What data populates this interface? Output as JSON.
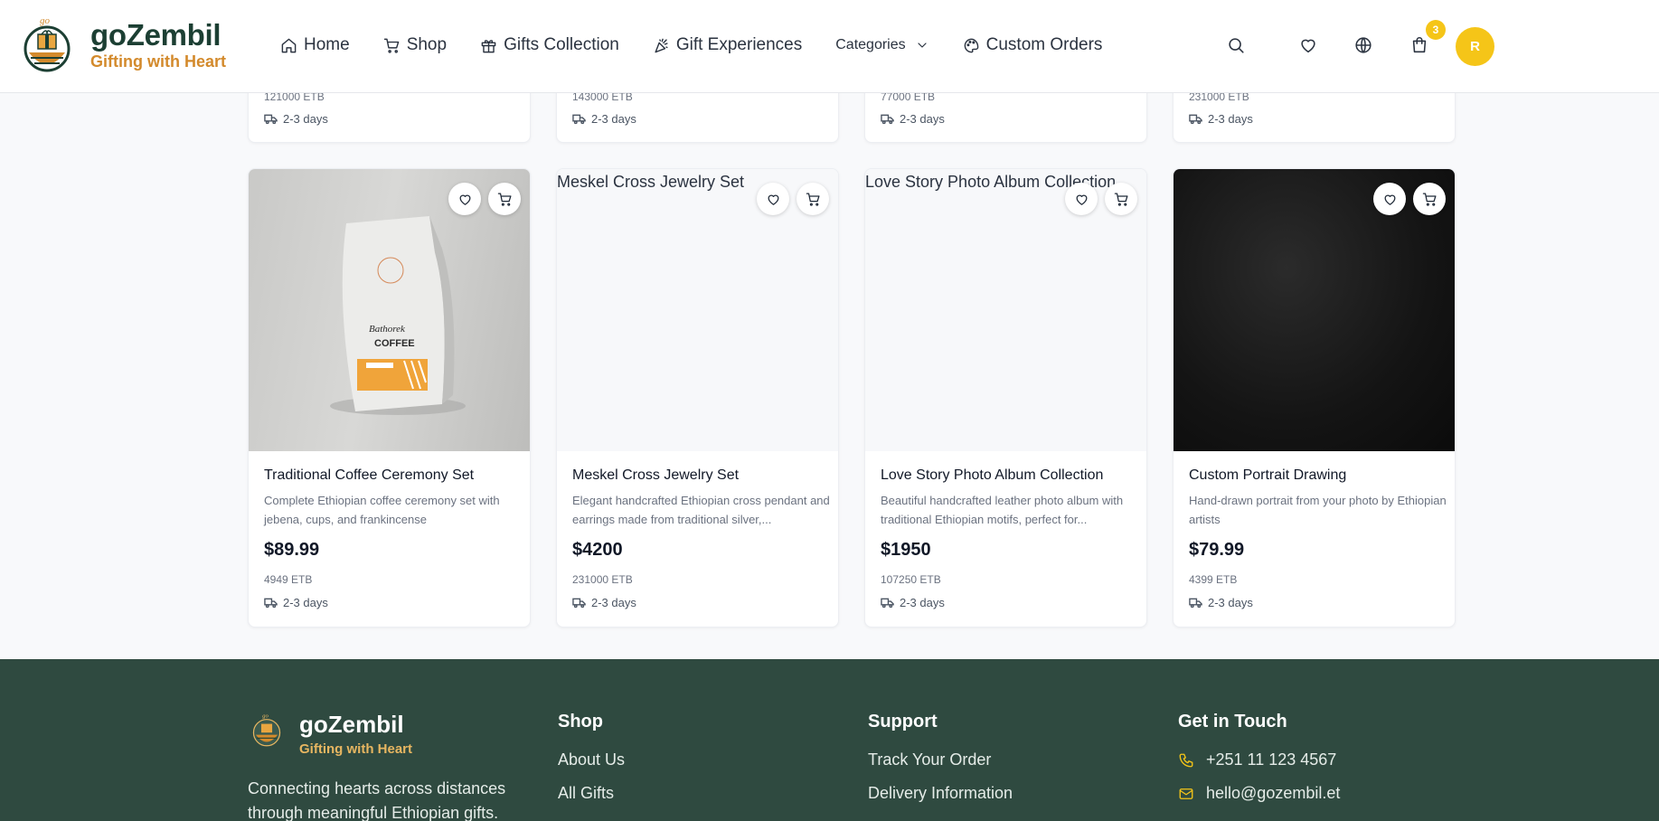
{
  "header": {
    "brand_name": "goZembil",
    "brand_tagline": "Gifting with Heart",
    "logo_text": "go",
    "nav": [
      {
        "label": "Home",
        "icon": "home-icon"
      },
      {
        "label": "Shop",
        "icon": "cart-icon"
      },
      {
        "label": "Gifts Collection",
        "icon": "gift-icon"
      },
      {
        "label": "Gift Experiences",
        "icon": "party-popper-icon"
      },
      {
        "label": "Categories",
        "icon": "chevron-down-icon"
      },
      {
        "label": "Custom Orders",
        "icon": "palette-icon"
      }
    ],
    "cart_count": "3",
    "avatar_initial": "R"
  },
  "top_row": [
    {
      "etb": "121000 ETB",
      "shipping": "2-3 days"
    },
    {
      "etb": "143000 ETB",
      "shipping": "2-3 days"
    },
    {
      "etb": "77000 ETB",
      "shipping": "2-3 days"
    },
    {
      "etb": "231000 ETB",
      "shipping": "2-3 days"
    }
  ],
  "products": [
    {
      "title": "Traditional Coffee Ceremony Set",
      "description": "Complete Ethiopian coffee ceremony set with jebena, cups, and frankincense",
      "price": "$89.99",
      "etb": "4949 ETB",
      "shipping": "2-3 days",
      "image_alt": "",
      "bag_text_1": "Bathorek",
      "bag_text_2": "COFFEE"
    },
    {
      "title": "Meskel Cross Jewelry Set",
      "description": "Elegant handcrafted Ethiopian cross pendant and earrings made from traditional silver,...",
      "price": "$4200",
      "etb": "231000 ETB",
      "shipping": "2-3 days",
      "image_alt": "Meskel Cross Jewelry Set"
    },
    {
      "title": "Love Story Photo Album Collection",
      "description": "Beautiful handcrafted leather photo album with traditional Ethiopian motifs, perfect for...",
      "price": "$1950",
      "etb": "107250 ETB",
      "shipping": "2-3 days",
      "image_alt": "Love Story Photo Album Collection"
    },
    {
      "title": "Custom Portrait Drawing",
      "description": "Hand-drawn portrait from your photo by Ethiopian artists",
      "price": "$79.99",
      "etb": "4399 ETB",
      "shipping": "2-3 days",
      "image_alt": ""
    }
  ],
  "footer": {
    "brand_name": "goZembil",
    "brand_tagline": "Gifting with Heart",
    "about": "Connecting hearts across distances through meaningful Ethiopian gifts.",
    "shop": {
      "heading": "Shop",
      "links": [
        "About Us",
        "All Gifts"
      ]
    },
    "support": {
      "heading": "Support",
      "links": [
        "Track Your Order",
        "Delivery Information"
      ]
    },
    "contact": {
      "heading": "Get in Touch",
      "phone": "+251 11 123 4567",
      "email": "hello@gozembil.et"
    }
  },
  "colors": {
    "brand_green": "#1c3f33",
    "brand_orange": "#d38a2c",
    "accent_yellow": "#f5c518",
    "footer_bg": "#2f4a40"
  }
}
